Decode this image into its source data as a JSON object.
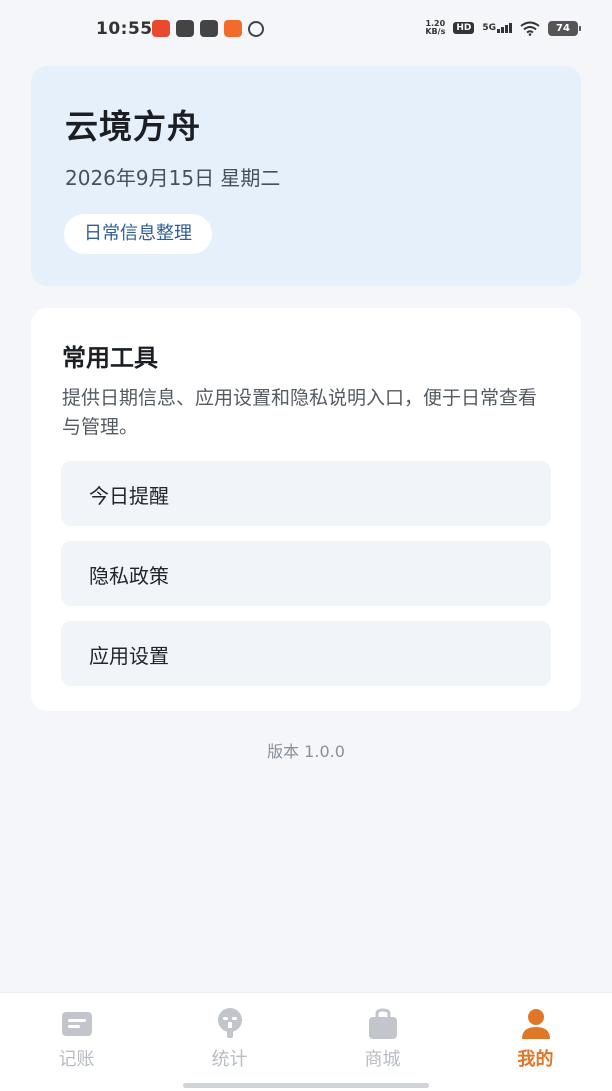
{
  "status_bar": {
    "time": "10:55",
    "net_speed_value": "1.20",
    "net_speed_unit": "KB/s",
    "hd_label": "HD",
    "network_label": "5G",
    "battery_level": "74"
  },
  "header": {
    "app_name": "云境方舟",
    "date": "2026年9月15日 星期二",
    "tag": "日常信息整理"
  },
  "tools": {
    "title": "常用工具",
    "description": "提供日期信息、应用设置和隐私说明入口，便于日常查看与管理。",
    "items": [
      {
        "label": "今日提醒"
      },
      {
        "label": "隐私政策"
      },
      {
        "label": "应用设置"
      }
    ]
  },
  "version": "版本 1.0.0",
  "tab_bar": {
    "tabs": [
      {
        "label": "记账",
        "icon": "ledger-icon"
      },
      {
        "label": "统计",
        "icon": "stats-icon"
      },
      {
        "label": "商城",
        "icon": "shopping-bag-icon"
      },
      {
        "label": "我的",
        "icon": "person-icon"
      }
    ],
    "active_index": 3
  },
  "colors": {
    "accent": "#e07628",
    "header_bg": "#e6f0fb",
    "tag_text": "#2f5f95",
    "page_bg": "#f4f6fa",
    "inactive_tab": "#b8bcc3"
  }
}
